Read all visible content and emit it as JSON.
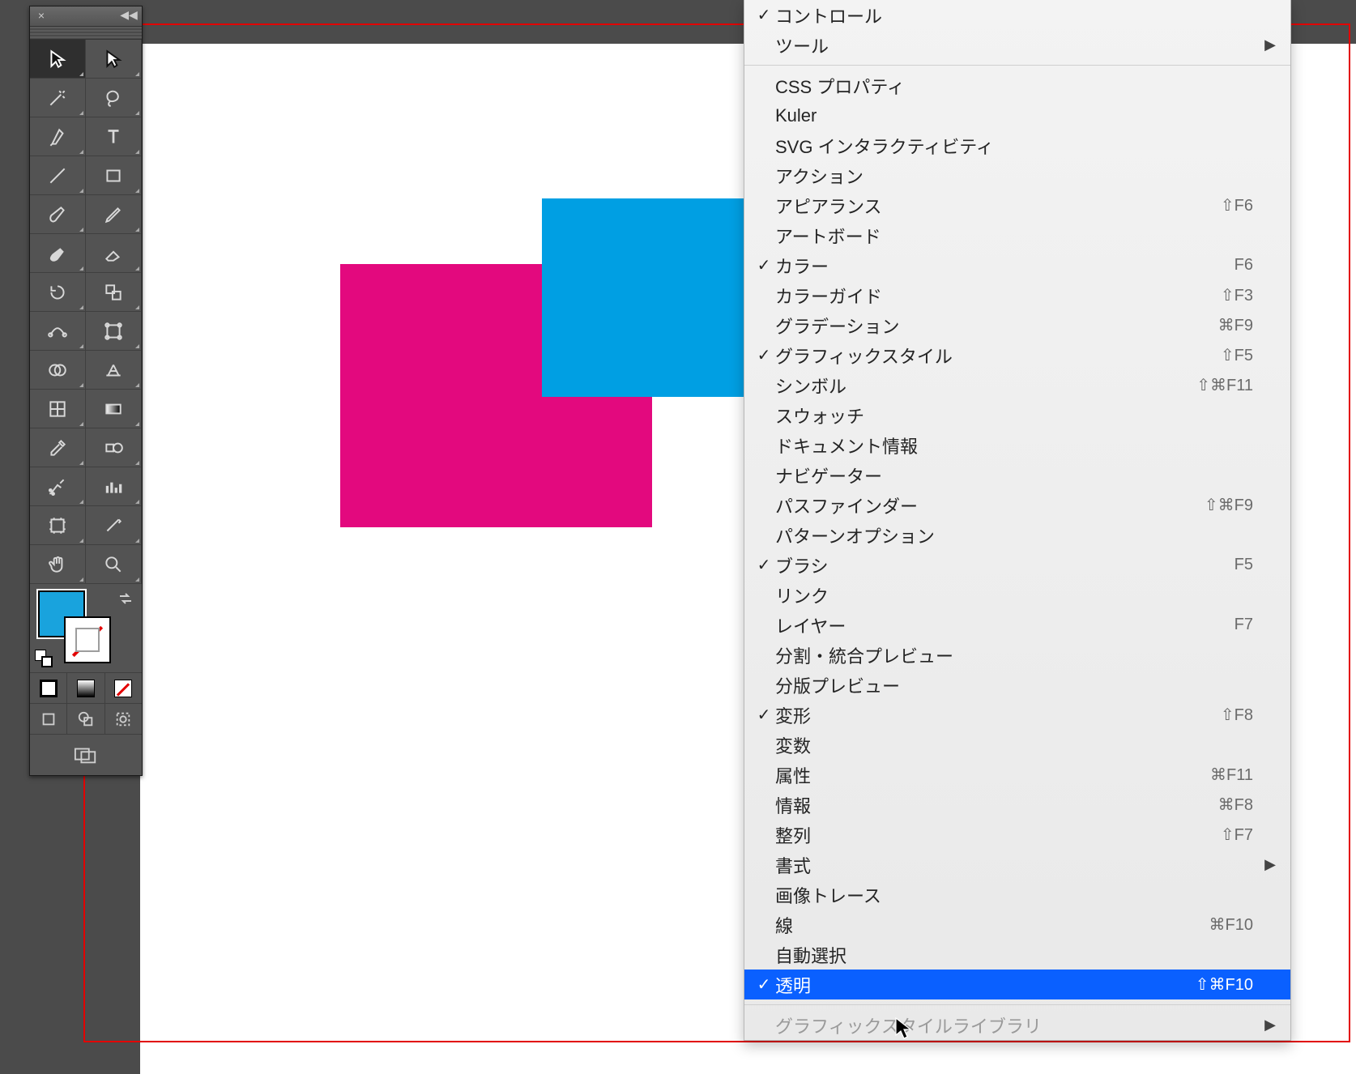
{
  "canvas": {
    "shapes": {
      "magenta_rect": {
        "fill": "#e3097e"
      },
      "blue_rect": {
        "fill": "#009fe3"
      }
    }
  },
  "tools_panel": {
    "close": "×",
    "collapse": "◀◀",
    "tools": [
      {
        "name": "selection-tool",
        "selected": true
      },
      {
        "name": "direct-selection-tool",
        "selected": false
      },
      {
        "name": "magic-wand-tool",
        "selected": false
      },
      {
        "name": "lasso-tool",
        "selected": false
      },
      {
        "name": "pen-tool",
        "selected": false
      },
      {
        "name": "type-tool",
        "selected": false
      },
      {
        "name": "line-segment-tool",
        "selected": false
      },
      {
        "name": "rectangle-tool",
        "selected": false
      },
      {
        "name": "paintbrush-tool",
        "selected": false
      },
      {
        "name": "pencil-tool",
        "selected": false
      },
      {
        "name": "blob-brush-tool",
        "selected": false
      },
      {
        "name": "eraser-tool",
        "selected": false
      },
      {
        "name": "rotate-tool",
        "selected": false
      },
      {
        "name": "scale-tool",
        "selected": false
      },
      {
        "name": "width-tool",
        "selected": false
      },
      {
        "name": "free-transform-tool",
        "selected": false
      },
      {
        "name": "shape-builder-tool",
        "selected": false
      },
      {
        "name": "perspective-grid-tool",
        "selected": false
      },
      {
        "name": "mesh-tool",
        "selected": false
      },
      {
        "name": "gradient-tool",
        "selected": false
      },
      {
        "name": "eyedropper-tool",
        "selected": false
      },
      {
        "name": "blend-tool",
        "selected": false
      },
      {
        "name": "symbol-sprayer-tool",
        "selected": false
      },
      {
        "name": "column-graph-tool",
        "selected": false
      },
      {
        "name": "artboard-tool",
        "selected": false
      },
      {
        "name": "slice-tool",
        "selected": false
      },
      {
        "name": "hand-tool",
        "selected": false
      },
      {
        "name": "zoom-tool",
        "selected": false
      }
    ],
    "fill_color": "#19a3dd",
    "stroke": "none"
  },
  "menu": {
    "items": [
      {
        "label": "コントロール",
        "checked": true,
        "shortcut": "",
        "submenu": false
      },
      {
        "label": "ツール",
        "checked": false,
        "shortcut": "",
        "submenu": true
      },
      {
        "sep": true
      },
      {
        "label": "CSS プロパティ",
        "checked": false,
        "shortcut": "",
        "submenu": false
      },
      {
        "label": "Kuler",
        "checked": false,
        "shortcut": "",
        "submenu": false
      },
      {
        "label": "SVG インタラクティビティ",
        "checked": false,
        "shortcut": "",
        "submenu": false
      },
      {
        "label": "アクション",
        "checked": false,
        "shortcut": "",
        "submenu": false
      },
      {
        "label": "アピアランス",
        "checked": false,
        "shortcut": "⇧F6",
        "submenu": false
      },
      {
        "label": "アートボード",
        "checked": false,
        "shortcut": "",
        "submenu": false
      },
      {
        "label": "カラー",
        "checked": true,
        "shortcut": "F6",
        "submenu": false
      },
      {
        "label": "カラーガイド",
        "checked": false,
        "shortcut": "⇧F3",
        "submenu": false
      },
      {
        "label": "グラデーション",
        "checked": false,
        "shortcut": "⌘F9",
        "submenu": false
      },
      {
        "label": "グラフィックスタイル",
        "checked": true,
        "shortcut": "⇧F5",
        "submenu": false
      },
      {
        "label": "シンボル",
        "checked": false,
        "shortcut": "⇧⌘F11",
        "submenu": false
      },
      {
        "label": "スウォッチ",
        "checked": false,
        "shortcut": "",
        "submenu": false
      },
      {
        "label": "ドキュメント情報",
        "checked": false,
        "shortcut": "",
        "submenu": false
      },
      {
        "label": "ナビゲーター",
        "checked": false,
        "shortcut": "",
        "submenu": false
      },
      {
        "label": "パスファインダー",
        "checked": false,
        "shortcut": "⇧⌘F9",
        "submenu": false
      },
      {
        "label": "パターンオプション",
        "checked": false,
        "shortcut": "",
        "submenu": false
      },
      {
        "label": "ブラシ",
        "checked": true,
        "shortcut": "F5",
        "submenu": false
      },
      {
        "label": "リンク",
        "checked": false,
        "shortcut": "",
        "submenu": false
      },
      {
        "label": "レイヤー",
        "checked": false,
        "shortcut": "F7",
        "submenu": false
      },
      {
        "label": "分割・統合プレビュー",
        "checked": false,
        "shortcut": "",
        "submenu": false
      },
      {
        "label": "分版プレビュー",
        "checked": false,
        "shortcut": "",
        "submenu": false
      },
      {
        "label": "変形",
        "checked": true,
        "shortcut": "⇧F8",
        "submenu": false
      },
      {
        "label": "変数",
        "checked": false,
        "shortcut": "",
        "submenu": false
      },
      {
        "label": "属性",
        "checked": false,
        "shortcut": "⌘F11",
        "submenu": false
      },
      {
        "label": "情報",
        "checked": false,
        "shortcut": "⌘F8",
        "submenu": false
      },
      {
        "label": "整列",
        "checked": false,
        "shortcut": "⇧F7",
        "submenu": false
      },
      {
        "label": "書式",
        "checked": false,
        "shortcut": "",
        "submenu": true
      },
      {
        "label": "画像トレース",
        "checked": false,
        "shortcut": "",
        "submenu": false
      },
      {
        "label": "線",
        "checked": false,
        "shortcut": "⌘F10",
        "submenu": false
      },
      {
        "label": "自動選択",
        "checked": false,
        "shortcut": "",
        "submenu": false
      },
      {
        "label": "透明",
        "checked": true,
        "shortcut": "⇧⌘F10",
        "submenu": false,
        "selected": true
      },
      {
        "sep": true
      },
      {
        "label": "グラフィックスタイルライブラリ",
        "checked": false,
        "shortcut": "",
        "submenu": true,
        "disabled": true
      }
    ]
  }
}
